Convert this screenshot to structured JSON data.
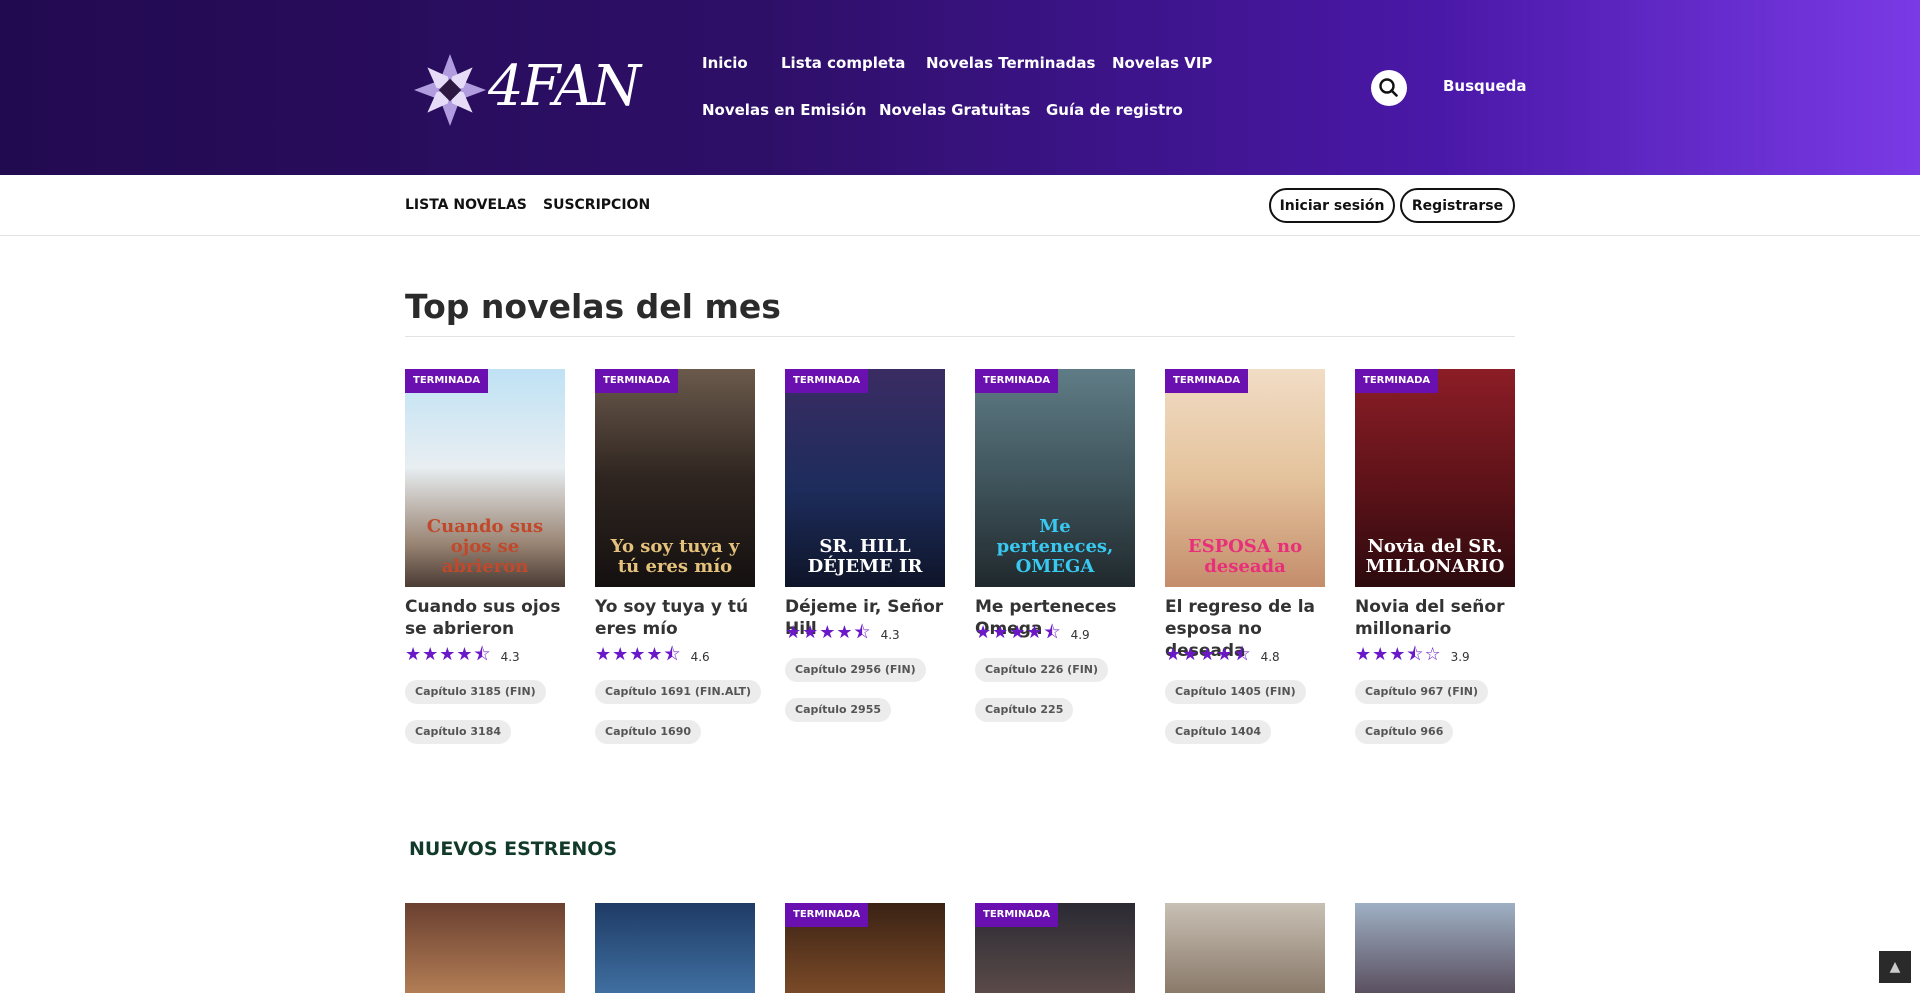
{
  "header": {
    "logo_text": "4FAN",
    "nav_row1": [
      "Inicio",
      "Lista completa",
      "Novelas Terminadas",
      "Novelas VIP"
    ],
    "nav_row2": [
      "Novelas en Emisión",
      "Novelas Gratuitas",
      "Guía de registro"
    ],
    "search_label": "Busqueda"
  },
  "subbar": {
    "links": [
      "LISTA NOVELAS",
      "SUSCRIPCION"
    ],
    "login": "Iniciar sesión",
    "register": "Registrarse"
  },
  "top": {
    "title": "Top novelas del mes",
    "badge": "TERMINADA",
    "novels": [
      {
        "title": "Cuando sus ojos se abrieron",
        "rating": 4.3,
        "score": "4.3",
        "chapters": [
          "Capítulo 3185 (FIN)",
          "Capítulo 3184"
        ],
        "cover_text": "Cuando sus ojos se abrieron",
        "cover_bg": "linear-gradient(180deg,#bfe2f4 0%,#e8eef2 45%,#9a8574 80%,#4a3b34 100%)",
        "cover_color": "#c0492c"
      },
      {
        "title": "Yo soy tuya y tú eres mío",
        "rating": 4.6,
        "score": "4.6",
        "chapters": [
          "Capítulo 1691 (FIN.ALT)",
          "Capítulo 1690"
        ],
        "cover_text": "Yo soy tuya y tú eres mío",
        "cover_bg": "linear-gradient(180deg,#6b5a4c 0%,#2f2520 50%,#141010 100%)",
        "cover_color": "#e4c27c"
      },
      {
        "title": "Déjeme ir, Señor Hill",
        "rating": 4.3,
        "score": "4.3",
        "chapters": [
          "Capítulo 2956 (FIN)",
          "Capítulo 2955"
        ],
        "cover_text": "SR. HILL DÉJEME IR",
        "cover_bg": "linear-gradient(180deg,#3a2c63 0%,#1d2c5c 55%,#0e1428 100%)",
        "cover_color": "#ffffff"
      },
      {
        "title": "Me perteneces Omega",
        "rating": 4.9,
        "score": "4.9",
        "chapters": [
          "Capítulo 226 (FIN)",
          "Capítulo 225"
        ],
        "cover_text": "Me perteneces, OMEGA",
        "cover_bg": "linear-gradient(180deg,#5f7c86 0%,#3d5158 55%,#20292d 100%)",
        "cover_color": "#38c8f0"
      },
      {
        "title": "El regreso de la esposa no deseada",
        "rating": 4.8,
        "score": "4.8",
        "chapters": [
          "Capítulo 1405 (FIN)",
          "Capítulo 1404"
        ],
        "cover_text": "ESPOSA no deseada",
        "cover_bg": "linear-gradient(180deg,#f1dcc5 0%,#e4c39c 50%,#c48d6c 100%)",
        "cover_color": "#e8307a"
      },
      {
        "title": "Novia del señor millonario",
        "rating": 3.9,
        "score": "3.9",
        "chapters": [
          "Capítulo 967 (FIN)",
          "Capítulo 966"
        ],
        "cover_text": "Novia del SR. MILLONARIO",
        "cover_bg": "linear-gradient(180deg,#8c1d26 0%,#5c1218 55%,#2c0a0e 100%)",
        "cover_color": "#ffffff"
      }
    ]
  },
  "estrenos": {
    "title": "NUEVOS ESTRENOS",
    "badge": "TERMINADA",
    "items": [
      {
        "badge": false,
        "bg": "linear-gradient(180deg,#6a4030 0%,#b27d55 100%)"
      },
      {
        "badge": false,
        "bg": "linear-gradient(180deg,#1f3b66 0%,#3f6fa0 100%)"
      },
      {
        "badge": true,
        "bg": "linear-gradient(180deg,#3a2214 0%,#7a4a28 100%)"
      },
      {
        "badge": true,
        "bg": "linear-gradient(180deg,#2a2a33 0%,#5a4a48 100%)"
      },
      {
        "badge": false,
        "bg": "linear-gradient(180deg,#c8c0b4 0%,#8a7a6a 100%)"
      },
      {
        "badge": false,
        "bg": "linear-gradient(180deg,#9fb0c4 0%,#5a5060 100%)"
      }
    ]
  },
  "colors": {
    "accent": "#6a0fb0",
    "star": "#6a18c8"
  }
}
